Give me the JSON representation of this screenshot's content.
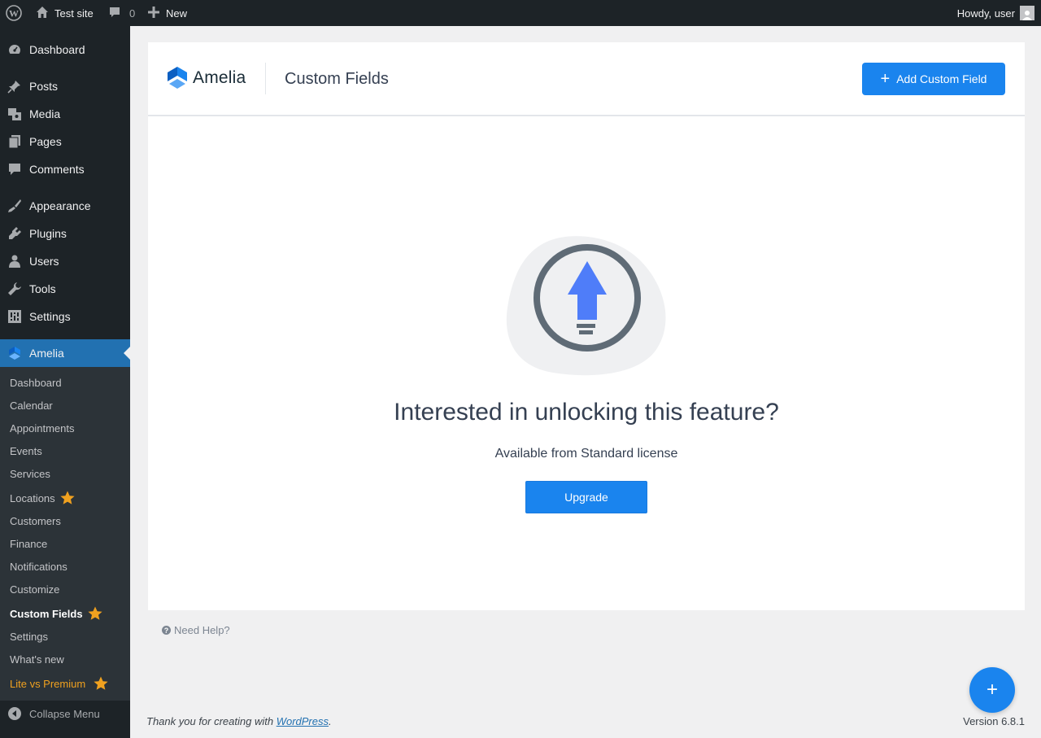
{
  "adminbar": {
    "site_name": "Test site",
    "comments_count": "0",
    "new_label": "New",
    "howdy": "Howdy, user"
  },
  "sidebar": {
    "items": [
      {
        "label": "Dashboard",
        "icon": "dashboard-icon"
      },
      {
        "label": "Posts",
        "icon": "pushpin-icon"
      },
      {
        "label": "Media",
        "icon": "media-icon"
      },
      {
        "label": "Pages",
        "icon": "pages-icon"
      },
      {
        "label": "Comments",
        "icon": "comment-icon"
      },
      {
        "label": "Appearance",
        "icon": "paintbrush-icon"
      },
      {
        "label": "Plugins",
        "icon": "plugin-icon"
      },
      {
        "label": "Users",
        "icon": "user-icon"
      },
      {
        "label": "Tools",
        "icon": "wrench-icon"
      },
      {
        "label": "Settings",
        "icon": "settings-icon"
      },
      {
        "label": "Amelia",
        "icon": "amelia-icon",
        "current": true
      }
    ],
    "submenu": [
      {
        "label": "Dashboard"
      },
      {
        "label": "Calendar"
      },
      {
        "label": "Appointments"
      },
      {
        "label": "Events"
      },
      {
        "label": "Services"
      },
      {
        "label": "Locations",
        "star": true
      },
      {
        "label": "Customers"
      },
      {
        "label": "Finance"
      },
      {
        "label": "Notifications"
      },
      {
        "label": "Customize"
      },
      {
        "label": "Custom Fields",
        "star": true,
        "current": true
      },
      {
        "label": "Settings"
      },
      {
        "label": "What's new"
      },
      {
        "label": "Lite vs Premium",
        "star": true,
        "highlight": true
      }
    ],
    "collapse_label": "Collapse Menu"
  },
  "header": {
    "logo_text": "Amelia",
    "page_title": "Custom Fields",
    "add_button_label": "Add Custom Field"
  },
  "upsell": {
    "headline": "Interested in unlocking this feature?",
    "subline": "Available from Standard license",
    "upgrade_label": "Upgrade"
  },
  "help_label": "Need Help?",
  "footer": {
    "thanks_prefix": "Thank you for creating with ",
    "wordpress_link": "WordPress",
    "thanks_suffix": ".",
    "version": "Version 6.8.1"
  },
  "colors": {
    "accent": "#1a84ee",
    "wp_blue": "#2271b1",
    "sidebar_bg": "#1d2327",
    "star": "#f0a11f"
  }
}
